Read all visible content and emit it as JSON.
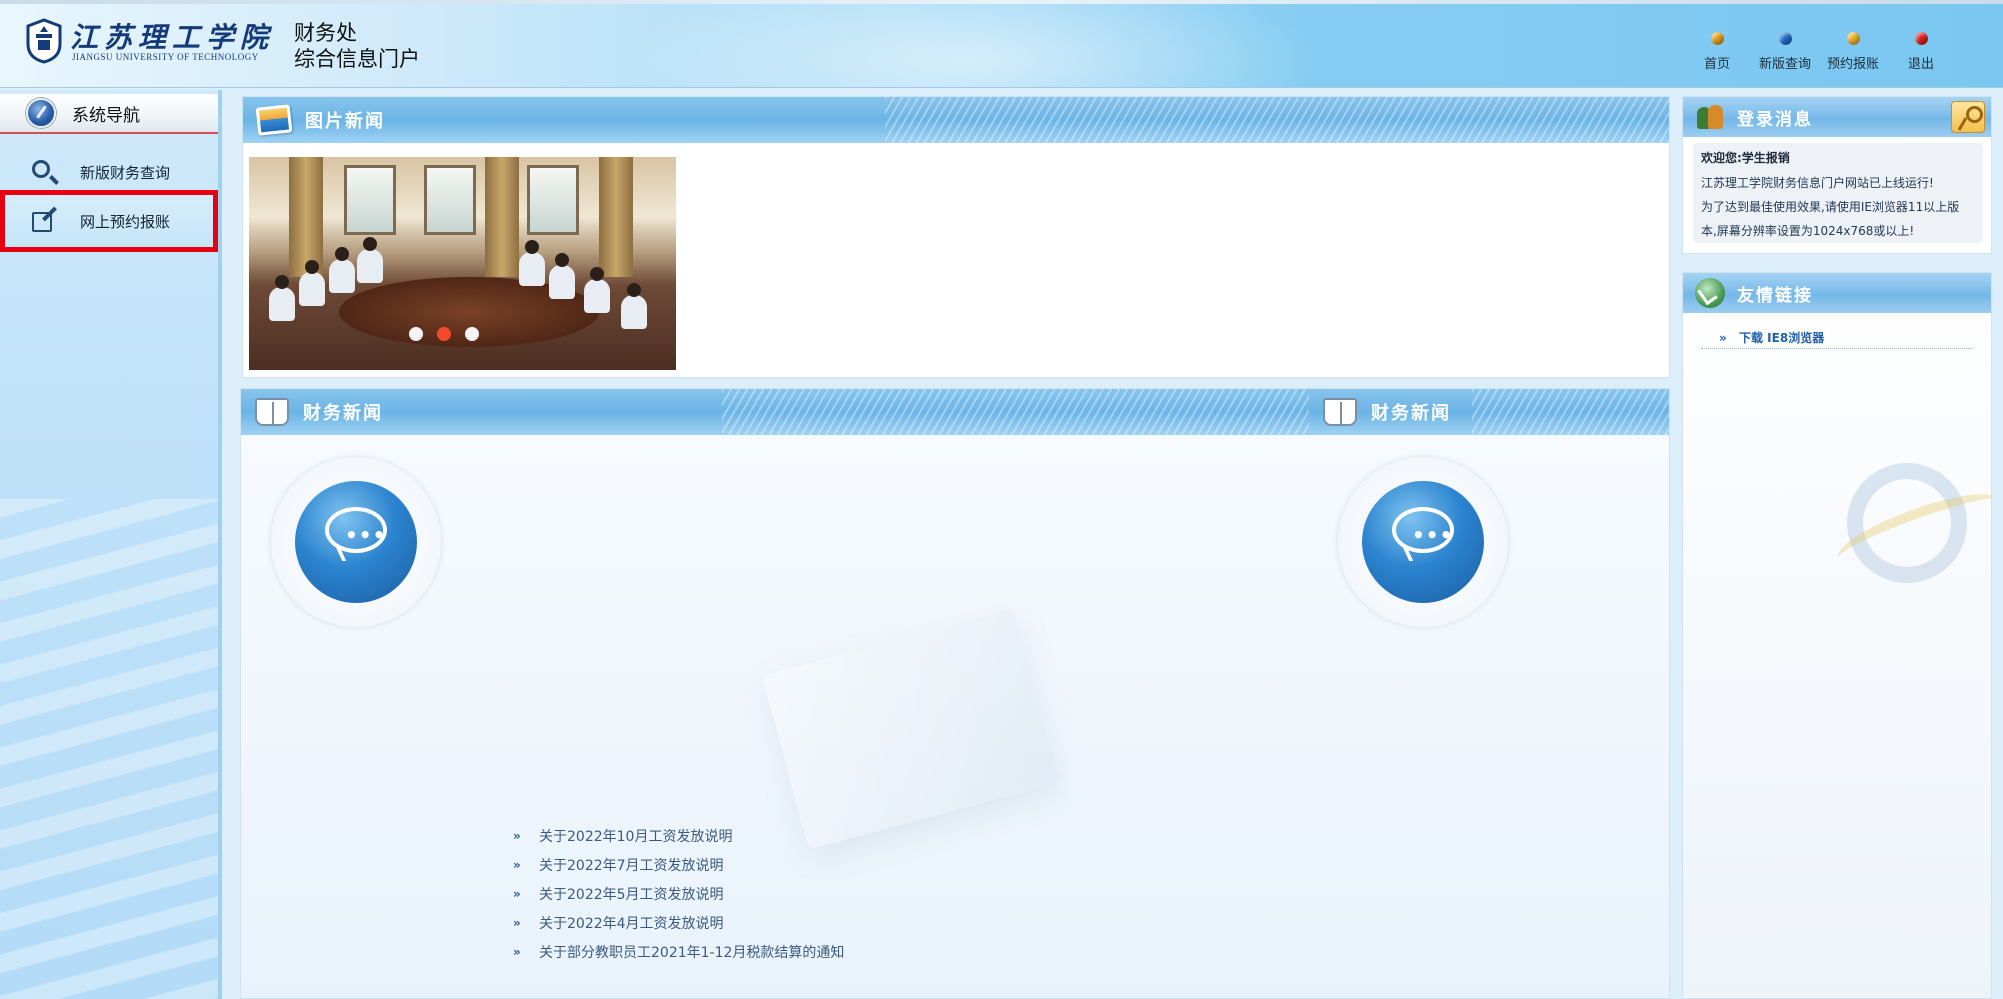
{
  "header": {
    "logo_cn": "江苏理工学院",
    "logo_en": "JIANGSU UNIVERSITY OF TECHNOLOGY",
    "title_line1": "财务处",
    "title_line2": "综合信息门户",
    "nav": [
      {
        "label": "首页",
        "icon": "home-dot-icon",
        "color": "#e8a21a"
      },
      {
        "label": "新版查询",
        "icon": "query-dot-icon",
        "color": "#1f6fd1"
      },
      {
        "label": "预约报账",
        "icon": "reserve-dot-icon",
        "color": "#f2b22b"
      },
      {
        "label": "退出",
        "icon": "exit-dot-icon",
        "color": "#e0201c"
      }
    ]
  },
  "sidebar": {
    "title": "系统导航",
    "items": [
      {
        "label": "新版财务查询",
        "icon": "search-icon"
      },
      {
        "label": "网上预约报账",
        "icon": "edit-icon",
        "highlighted": true
      }
    ]
  },
  "photo_news": {
    "title": "图片新闻",
    "slides": 3,
    "active_slide": 2
  },
  "finance_news_left": {
    "title": "财务新闻",
    "items": [
      "关于2022年10月工资发放说明",
      "关于2022年7月工资发放说明",
      "关于2022年5月工资发放说明",
      "关于2022年4月工资发放说明",
      "关于部分教职员工2021年1-12月税款结算的通知"
    ]
  },
  "finance_news_right": {
    "title": "财务新闻"
  },
  "login_message": {
    "title": "登录消息",
    "welcome": "欢迎您:学生报销",
    "lines": [
      "江苏理工学院财务信息门户网站已上线运行!",
      "为了达到最佳使用效果,请使用IE浏览器11以上版",
      "本,屏幕分辨率设置为1024x768或以上!"
    ]
  },
  "friend_links": {
    "title": "友情链接",
    "items": [
      {
        "label": "下载 IE8浏览器"
      }
    ]
  },
  "colors": {
    "accent": "#6bb4e6",
    "highlight_border": "#e60012",
    "slider_active": "#f24a2a"
  }
}
